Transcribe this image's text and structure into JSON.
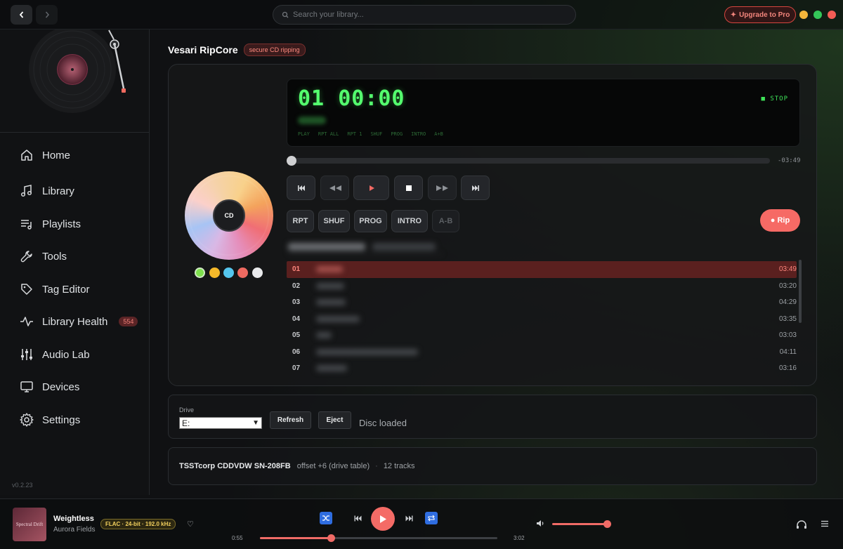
{
  "titlebar": {
    "search_placeholder": "Search your library...",
    "upgrade_label": "Upgrade to Pro",
    "window_dot_colors": [
      "#f4b63b",
      "#34c759",
      "#f55c55"
    ]
  },
  "sidebar": {
    "items": [
      {
        "label": "Home",
        "icon": "home-icon"
      },
      {
        "label": "Library",
        "icon": "music-note-icon"
      },
      {
        "label": "Playlists",
        "icon": "playlist-icon"
      },
      {
        "label": "Tools",
        "icon": "wrench-icon"
      },
      {
        "label": "Tag Editor",
        "icon": "tag-icon"
      },
      {
        "label": "Library Health",
        "icon": "pulse-icon",
        "badge": "554"
      },
      {
        "label": "Audio Lab",
        "icon": "sliders-icon"
      },
      {
        "label": "Devices",
        "icon": "monitor-icon"
      },
      {
        "label": "Settings",
        "icon": "gear-icon"
      }
    ],
    "version": "v0.2.23"
  },
  "header": {
    "title": "Vesari RipCore",
    "badge": "secure CD ripping"
  },
  "player": {
    "disc_label": "CD",
    "swatch_colors": [
      "#7ee04d",
      "#f5b92a",
      "#55c6ee",
      "#ee6a61",
      "#e9eaec"
    ],
    "lcd": {
      "track": "01",
      "time": "00:00",
      "status": "■ STOP",
      "modes": [
        "PLAY",
        "RPT ALL",
        "RPT 1",
        "SHUF",
        "PROG",
        "INTRO",
        "A+B"
      ]
    },
    "remaining": "-03:49",
    "transport_icons": [
      "skip-back-icon",
      "rewind-icon",
      "play-icon",
      "stop-icon",
      "fast-forward-icon",
      "skip-forward-icon"
    ],
    "mode_buttons": [
      "RPT",
      "SHUF",
      "PROG",
      "INTRO",
      "A-B"
    ],
    "rip_label": "● Rip",
    "tracks": [
      {
        "num": "01",
        "duration": "03:49"
      },
      {
        "num": "02",
        "duration": "03:20"
      },
      {
        "num": "03",
        "duration": "04:29"
      },
      {
        "num": "04",
        "duration": "03:35"
      },
      {
        "num": "05",
        "duration": "03:03"
      },
      {
        "num": "06",
        "duration": "04:11"
      },
      {
        "num": "07",
        "duration": "03:16"
      }
    ]
  },
  "drive": {
    "label": "Drive",
    "selected": "E:",
    "refresh": "Refresh",
    "eject": "Eject",
    "status": "Disc loaded"
  },
  "drive_info": {
    "model": "TSSTcorp CDDVDW SN-208FB",
    "offset": "offset +6 (drive table)",
    "tracks": "12 tracks"
  },
  "now_playing": {
    "art_text": "Spectral Drift",
    "title": "Weightless",
    "artist": "Aurora Fields",
    "quality": "FLAC · 24-bit · 192.0 kHz",
    "elapsed": "0:55",
    "total": "3:02",
    "progress_fraction": 0.3,
    "volume_fraction": 1.0
  }
}
